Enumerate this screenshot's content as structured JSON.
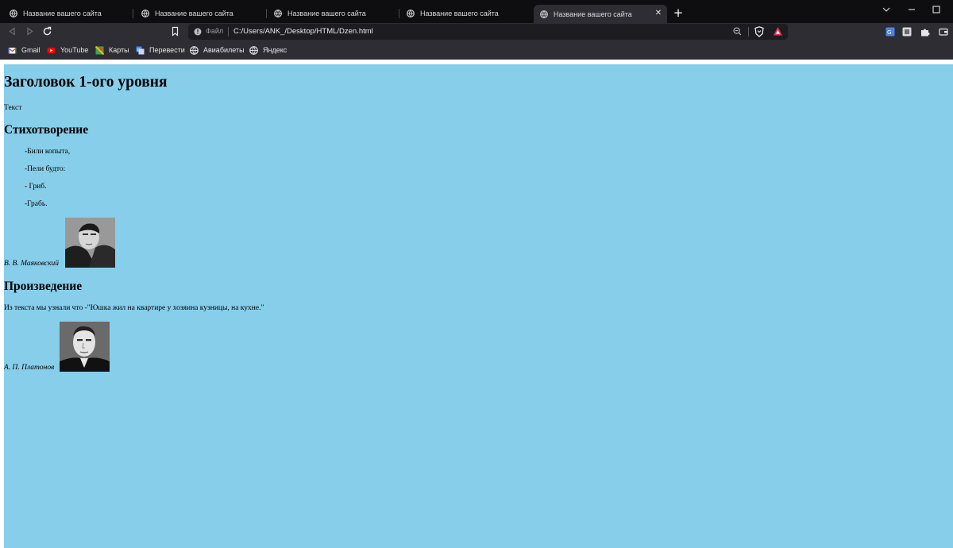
{
  "tabs": [
    {
      "title": "Название вашего сайта"
    },
    {
      "title": "Название вашего сайта"
    },
    {
      "title": "Название вашего сайта"
    },
    {
      "title": "Название вашего сайта"
    },
    {
      "title": "Название вашего сайта",
      "active": true
    }
  ],
  "tab_close_glyph": "✕",
  "new_tab_glyph": "+",
  "address_bar": {
    "scheme_label": "Файл",
    "url": "C:/Users/ANK_/Desktop/HTML/Dzen.html"
  },
  "bookmarks": [
    {
      "label": "Gmail",
      "icon": "gmail-icon"
    },
    {
      "label": "YouTube",
      "icon": "youtube-icon"
    },
    {
      "label": "Карты",
      "icon": "maps-icon"
    },
    {
      "label": "Перевести",
      "icon": "translate-icon"
    },
    {
      "label": "Авиабилеты",
      "icon": "globe-icon"
    },
    {
      "label": "Яндекс",
      "icon": "globe-icon"
    }
  ],
  "page": {
    "background": "#87ceea",
    "heading1": "Заголовок 1-ого уровня",
    "intro_text": "Текст",
    "poem_heading": "Стихотворение",
    "poem_lines": [
      "-Били копыта,",
      "-Пели будто:",
      "- Гриб.",
      "-Грабь."
    ],
    "poem_author": "В. В. Маяковский",
    "work_heading": "Произведение",
    "work_quote": "Из текста мы узнали что -\"Юшка жил на квартире у хозяина кузницы, на кухне.\"",
    "work_author": "А. П. Платонов"
  },
  "colors": {
    "tabstrip": "#0e0e10",
    "toolbar": "#2d2d33",
    "omnibox": "#1d1d21",
    "page_bg": "#87ceea"
  }
}
